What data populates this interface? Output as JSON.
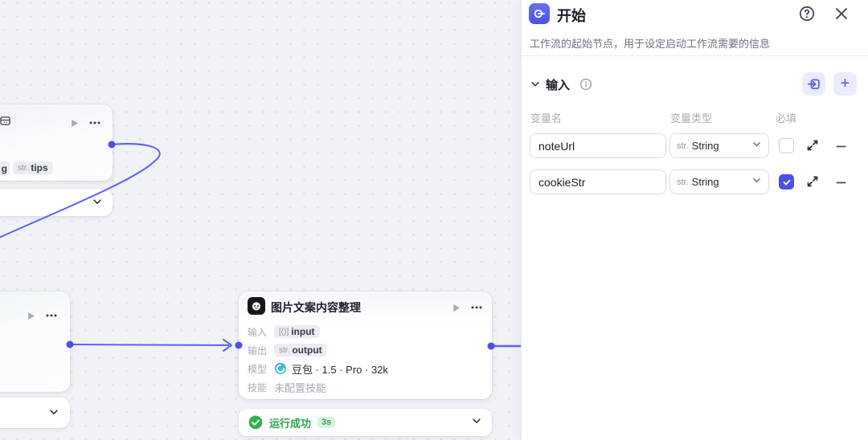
{
  "panel": {
    "title": "开始",
    "subtitle": "工作流的起始节点，用于设定启动工作流需要的信息",
    "input_section": {
      "label": "输入",
      "columns": {
        "name": "变量名",
        "type": "变量类型",
        "required": "必填"
      },
      "rows": [
        {
          "name": "noteUrl",
          "type_prefix": "str.",
          "type": "String",
          "required": false
        },
        {
          "name": "cookieStr",
          "type_prefix": "str.",
          "type": "String",
          "required": true
        }
      ]
    },
    "colors": {
      "accent": "#4e54e8",
      "accent_light": "#ecebfc"
    }
  },
  "canvas": {
    "top_left_node": {
      "partial_tag": "g",
      "tag_prefix": "str.",
      "tag": "tips"
    },
    "middle_node": {
      "title": "图片文案内容整理",
      "input_label": "输入",
      "input_tag_prefix": "[()]",
      "input_tag": "input",
      "output_label": "输出",
      "output_tag_prefix": "str.",
      "output_tag": "output",
      "model_label": "模型",
      "model_value": "豆包 · 1.5 · Pro · 32k",
      "skill_label": "技能",
      "skill_value": "未配置技能",
      "status": {
        "text": "运行成功",
        "duration": "3s"
      }
    },
    "colors": {
      "edge": "#5b62f1",
      "port": "#4b50e6",
      "success": "#2fb34f"
    }
  }
}
